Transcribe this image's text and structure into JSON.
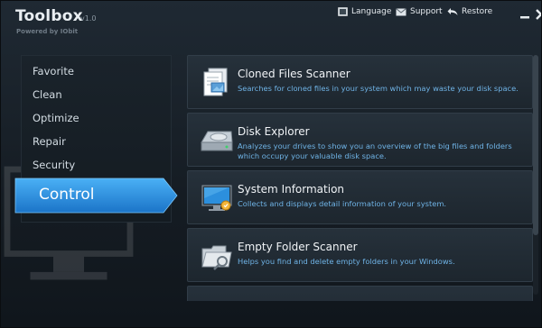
{
  "app": {
    "title": "Toolbox",
    "version": "v1.0",
    "subtitle": "Powered by IObit"
  },
  "toolbar": {
    "language": "Language",
    "support": "Support",
    "restore": "Restore"
  },
  "sidebar": {
    "items": [
      {
        "label": "Favorite"
      },
      {
        "label": "Clean"
      },
      {
        "label": "Optimize"
      },
      {
        "label": "Repair"
      },
      {
        "label": "Security"
      }
    ],
    "active": {
      "label": "Control"
    }
  },
  "tools": [
    {
      "title": "Cloned Files Scanner",
      "description": "Searches for cloned files in your system which may waste your disk space.",
      "icon": "cloned-files-icon"
    },
    {
      "title": "Disk Explorer",
      "description": "Analyzes your drives to show you an overview of the big files and folders which occupy your valuable disk space.",
      "icon": "disk-explorer-icon"
    },
    {
      "title": "System Information",
      "description": "Collects and displays detail information of your system.",
      "icon": "system-information-icon"
    },
    {
      "title": "Empty Folder Scanner",
      "description": "Helps you find and delete empty folders in your Windows.",
      "icon": "empty-folder-icon"
    }
  ],
  "colors": {
    "accent": "#2a8fe0",
    "description_text": "#6fb3e6"
  }
}
